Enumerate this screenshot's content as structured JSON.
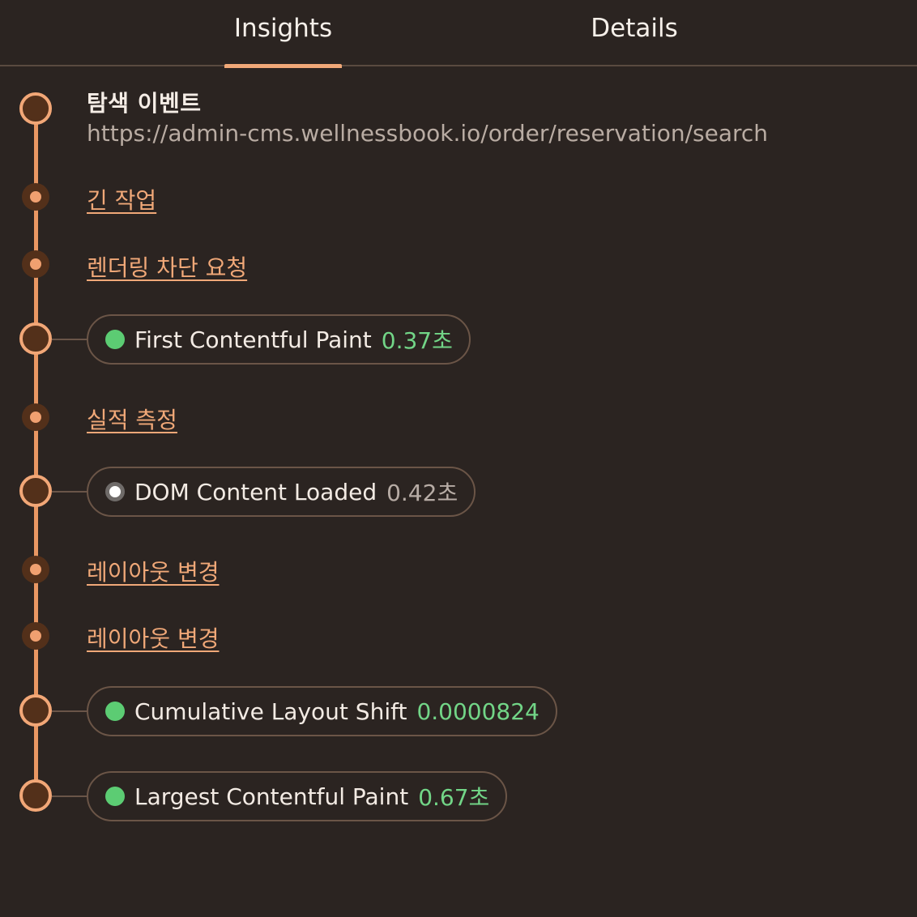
{
  "tabs": [
    {
      "label": "Insights",
      "active": true
    },
    {
      "label": "Details",
      "active": false
    }
  ],
  "event": {
    "title": "탐색 이벤트",
    "url": "https://admin-cms.wellnessbook.io/order/reservation/search"
  },
  "insights": {
    "long_task": "긴 작업",
    "render_blocking": "렌더링 차단 요청",
    "performance": "실적 측정",
    "layout_shift_1": "레이아웃 변경",
    "layout_shift_2": "레이아웃 변경"
  },
  "metrics": {
    "fcp": {
      "label": "First Contentful Paint",
      "value": "0.37초",
      "status": "good"
    },
    "dcl": {
      "label": "DOM Content Loaded",
      "value": "0.42초",
      "status": "neutral"
    },
    "cls": {
      "label": "Cumulative Layout Shift",
      "value": "0.0000824",
      "status": "good"
    },
    "lcp": {
      "label": "Largest Contentful Paint",
      "value": "0.67초",
      "status": "good"
    }
  },
  "colors": {
    "background": "#2b2421",
    "accent": "#f0a878",
    "good": "#5ccc73",
    "neutral": "#b7aca5"
  }
}
